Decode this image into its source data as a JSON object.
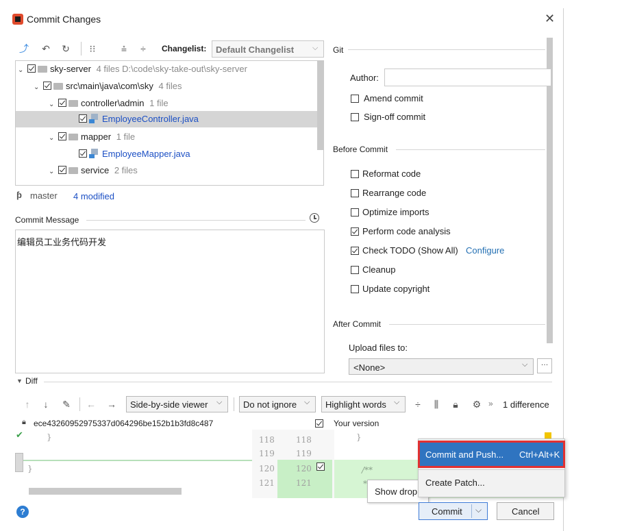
{
  "window": {
    "title": "Commit Changes"
  },
  "toolbar": {
    "changelist_label": "Changelist:",
    "changelist_value": "Default Changelist"
  },
  "tree": {
    "root": {
      "name": "sky-server",
      "meta": "4 files  D:\\code\\sky-take-out\\sky-server"
    },
    "src": {
      "name": "src\\main\\java\\com\\sky",
      "meta": "4 files"
    },
    "controller": {
      "name": "controller\\admin",
      "meta": "1 file"
    },
    "controller_file": "EmployeeController.java",
    "mapper": {
      "name": "mapper",
      "meta": "1 file"
    },
    "mapper_file": "EmployeeMapper.java",
    "service": {
      "name": "service",
      "meta": "2 files"
    }
  },
  "branch": {
    "name": "master",
    "modified": "4 modified"
  },
  "commit_message": {
    "label": "Commit Message",
    "text": "编辑员工业务代码开发"
  },
  "git": {
    "section_label": "Git",
    "author_label": "Author:",
    "author_value": "",
    "amend": "Amend commit",
    "signoff": "Sign-off commit"
  },
  "before_commit": {
    "label": "Before Commit",
    "reformat": "Reformat code",
    "rearrange": "Rearrange code",
    "optimize": "Optimize imports",
    "analysis": "Perform code analysis",
    "todo": "Check TODO (Show All)",
    "configure": "Configure",
    "cleanup": "Cleanup",
    "copyright": "Update copyright"
  },
  "after_commit": {
    "label": "After Commit",
    "upload_label": "Upload files to:",
    "upload_value": "<None>"
  },
  "diff": {
    "label": "Diff",
    "viewer": "Side-by-side viewer",
    "ignore": "Do not ignore",
    "highlight": "Highlight words",
    "differences": "1 difference",
    "left_hash": "ece43260952975337d064296be152b1b3fd8c487",
    "right_label": "Your version",
    "left_lines": [
      "118",
      "119",
      "120",
      "121"
    ],
    "right_lines": [
      "118",
      "119",
      "120",
      "121"
    ],
    "code_left": [
      "}",
      "",
      "}",
      ""
    ],
    "code_right": [
      "}",
      "",
      "/**",
      "*"
    ]
  },
  "dropdown_menu": {
    "commit_push": "Commit and Push...",
    "commit_push_shortcut": "Ctrl+Alt+K",
    "create_patch": "Create Patch..."
  },
  "tooltip": {
    "text": "Show drop"
  },
  "buttons": {
    "help": "?",
    "commit": "Commit",
    "cancel": "Cancel"
  }
}
